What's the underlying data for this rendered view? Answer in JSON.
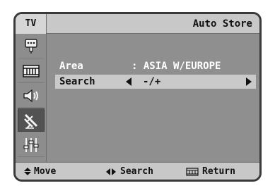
{
  "header": {
    "tv_tab": "TV",
    "title": "Auto Store"
  },
  "sidebar": {
    "items": [
      {
        "icon": "antenna-plug-icon"
      },
      {
        "icon": "film-strip-icon"
      },
      {
        "icon": "speaker-icon"
      },
      {
        "icon": "satellite-dish-icon",
        "active": true
      },
      {
        "icon": "equalizer-sliders-icon"
      }
    ]
  },
  "menu": {
    "area": {
      "label": "Area",
      "value": ": ASIA W/EUROPE"
    },
    "search": {
      "label": "Search",
      "value": "-/+"
    }
  },
  "footer": {
    "move": "Move",
    "search": "Search",
    "return": "Return"
  },
  "colors": {
    "frame": "#3a3a3a",
    "panel": "#8f8f8f",
    "bar": "#c8c8c8",
    "highlight": "#c9c9c9",
    "active_icon_bg": "#525252"
  }
}
